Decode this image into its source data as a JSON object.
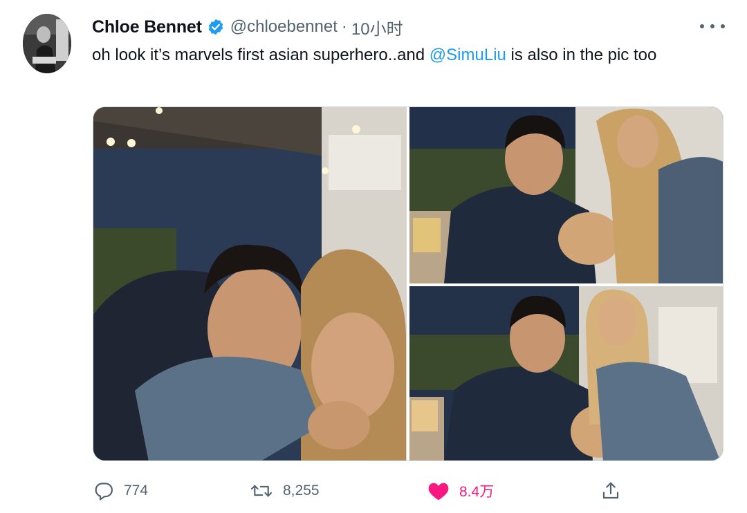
{
  "tweet": {
    "author_name": "Chloe Bennet",
    "handle": "@chloebennet",
    "separator": "·",
    "time": "10小时",
    "text_before": "oh look it’s marvels first asian superhero..and ",
    "mention": "@SimuLiu",
    "text_after": " is also in the pic too"
  },
  "actions": {
    "replies": "774",
    "retweets": "8,255",
    "likes": "8.4万"
  },
  "icons": {
    "verified": "verified-badge-icon",
    "more": "more-horizontal-icon",
    "reply": "reply-icon",
    "retweet": "retweet-icon",
    "like": "heart-filled-icon",
    "share": "share-icon"
  },
  "colors": {
    "accent": "#1d9bf0",
    "like": "#f91880",
    "secondary_text": "#536471"
  }
}
